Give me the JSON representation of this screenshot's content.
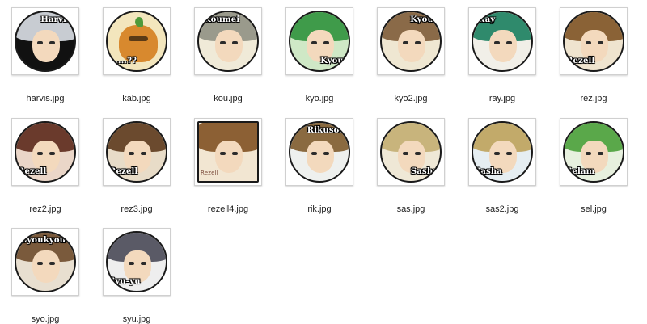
{
  "files": [
    {
      "name": "harvis.jpg",
      "caption": "Harvis",
      "tag_pos": "top-right",
      "bg": "#111111",
      "hair": "#c8ccd2"
    },
    {
      "name": "kab.jpg",
      "caption": "......??",
      "tag_pos": "bottom-left",
      "bg": "#f3e6bd",
      "hair": "",
      "pumpkin": true
    },
    {
      "name": "kou.jpg",
      "caption": "Koumei",
      "tag_pos": "top-left",
      "bg": "#f0ead8",
      "hair": "#9a9a8c"
    },
    {
      "name": "kyo.jpg",
      "caption": "Kyoui",
      "tag_pos": "bottom-right",
      "bg": "#cfe8c6",
      "hair": "#3f9b4a"
    },
    {
      "name": "kyo2.jpg",
      "caption": "Kyoui",
      "tag_pos": "top-right",
      "bg": "#efe7d2",
      "hair": "#8a6a48"
    },
    {
      "name": "ray.jpg",
      "caption": "Ray",
      "tag_pos": "top-left",
      "bg": "#f1efe8",
      "hair": "#2f8a6c"
    },
    {
      "name": "rez.jpg",
      "caption": "Rezell",
      "tag_pos": "bottom-left",
      "bg": "#efe4cf",
      "hair": "#8a6236"
    },
    {
      "name": "rez2.jpg",
      "caption": "Rezell",
      "tag_pos": "bottom-left",
      "bg": "#ead6c8",
      "hair": "#6a3a2c"
    },
    {
      "name": "rez3.jpg",
      "caption": "Rezell",
      "tag_pos": "bottom-left",
      "bg": "#e8dcc8",
      "hair": "#6b4a2e"
    },
    {
      "name": "rezell4.jpg",
      "caption": "Rezell",
      "tag_pos": "bottom-left",
      "bg": "#f2e6d2",
      "hair": "#8c6034",
      "square": true,
      "small_tag": true
    },
    {
      "name": "rik.jpg",
      "caption": "Rikuson",
      "tag_pos": "top-right",
      "bg": "#eef0ee",
      "hair": "#8a6a40"
    },
    {
      "name": "sas.jpg",
      "caption": "Sasha",
      "tag_pos": "bottom-right",
      "bg": "#efe8d6",
      "hair": "#c8b47c"
    },
    {
      "name": "sas2.jpg",
      "caption": "Sasha",
      "tag_pos": "bottom-left",
      "bg": "#e6eef2",
      "hair": "#c2aa6a"
    },
    {
      "name": "sel.jpg",
      "caption": "Selam",
      "tag_pos": "bottom-left",
      "bg": "#e7f0de",
      "hair": "#5aa84a"
    },
    {
      "name": "syo.jpg",
      "caption": "Syoukyou",
      "tag_pos": "top-left",
      "bg": "#e8dfd0",
      "hair": "#7a5a3c"
    },
    {
      "name": "syu.jpg",
      "caption": "Syu-yu",
      "tag_pos": "bottom-left",
      "bg": "#eeeeee",
      "hair": "#5a5a66"
    }
  ]
}
